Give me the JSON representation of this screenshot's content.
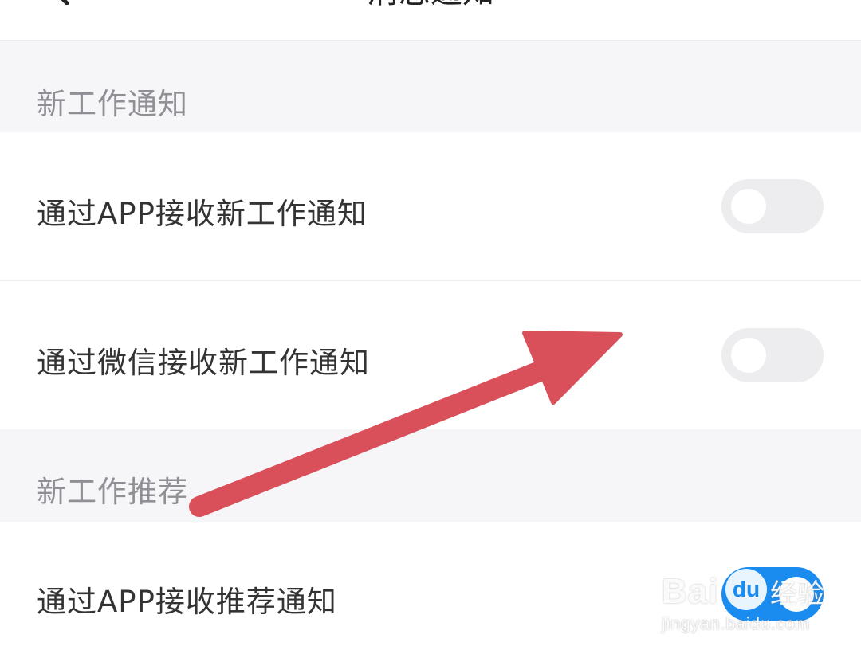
{
  "header": {
    "title": "消息通知",
    "back_icon": "chevron-left-icon"
  },
  "sections": [
    {
      "title": "新工作通知",
      "items": [
        {
          "label": "通过APP接收新工作通知",
          "enabled": false
        },
        {
          "label": "通过微信接收新工作通知",
          "enabled": false
        }
      ]
    },
    {
      "title": "新工作推荐",
      "items": [
        {
          "label": "通过APP接收推荐通知",
          "enabled": true
        }
      ]
    }
  ],
  "annotation": {
    "type": "arrow",
    "color": "#d9505a"
  },
  "watermark": {
    "brand": "Bai",
    "badge": "du",
    "product": "经验",
    "url": "jingyan.baidu.com"
  },
  "colors": {
    "toggle_on": "#1a8cf0",
    "toggle_off": "#ededf0",
    "section_bg": "#f6f6f8"
  }
}
